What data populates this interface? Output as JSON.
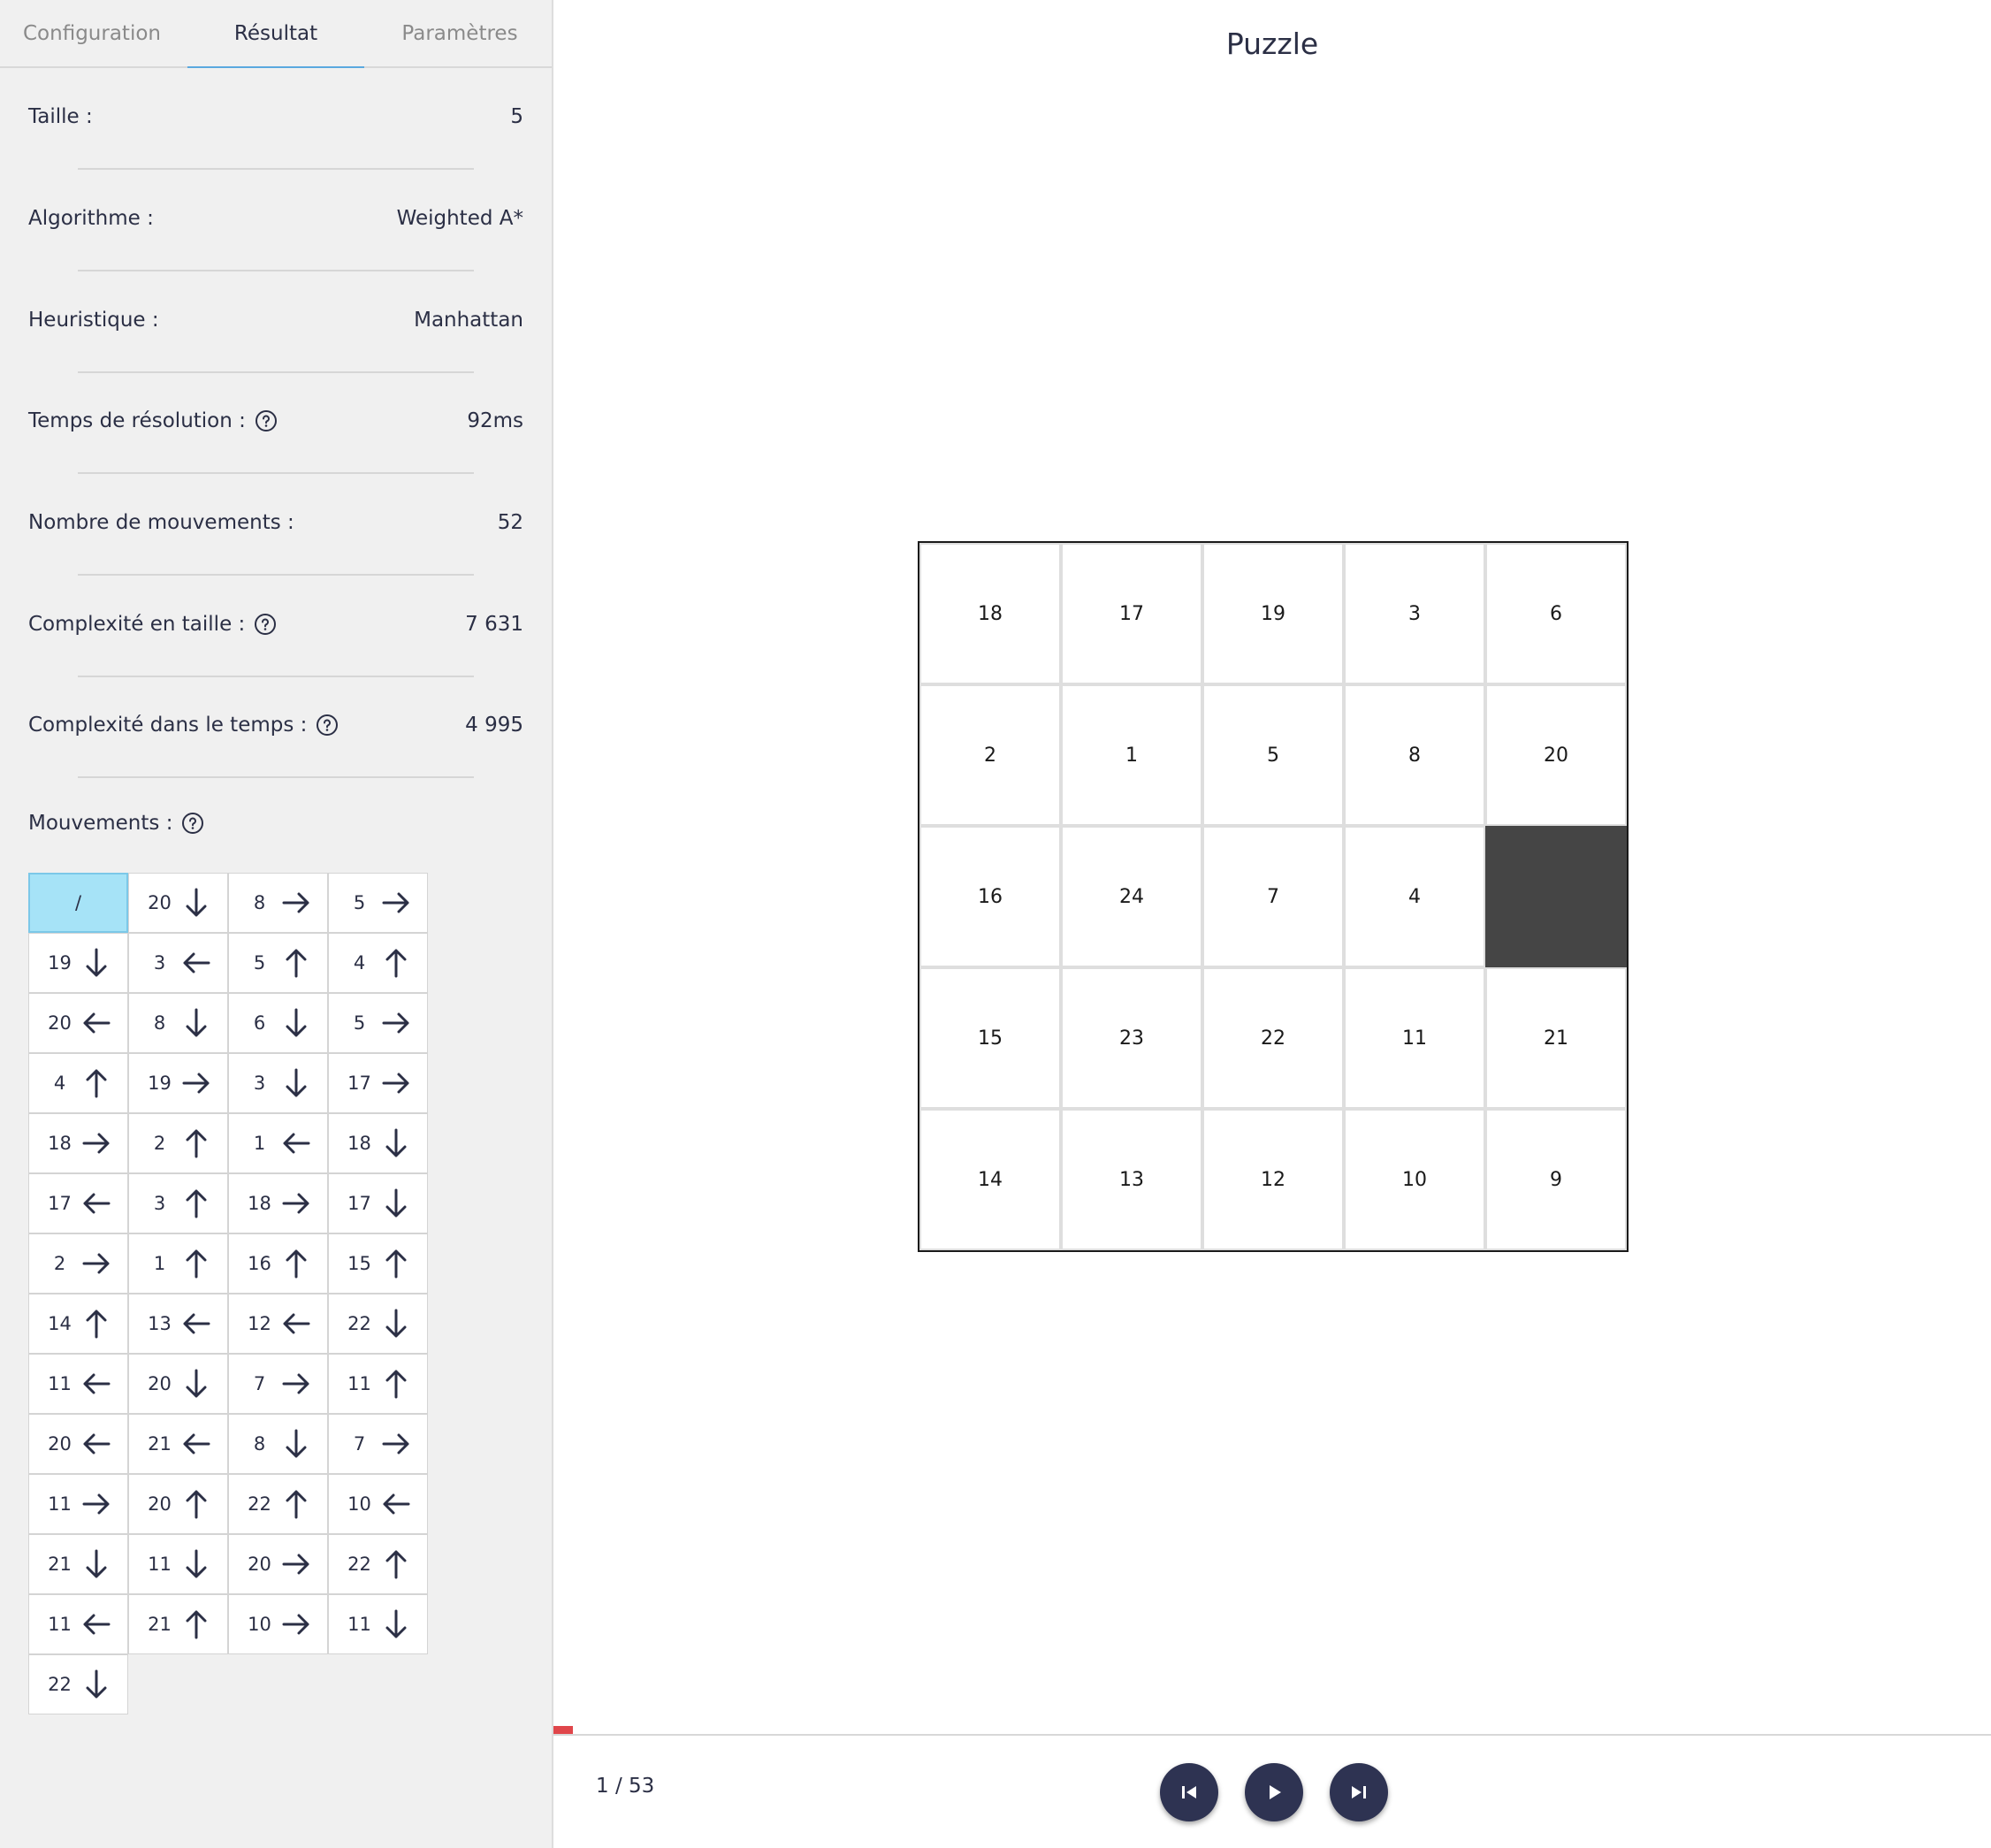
{
  "tabs": [
    {
      "label": "Configuration",
      "active": false
    },
    {
      "label": "Résultat",
      "active": true
    },
    {
      "label": "Paramètres",
      "active": false
    }
  ],
  "stats": [
    {
      "label": "Taille :",
      "value": "5",
      "help": false
    },
    {
      "label": "Algorithme :",
      "value": "Weighted A*",
      "help": false
    },
    {
      "label": "Heuristique :",
      "value": "Manhattan",
      "help": false
    },
    {
      "label": "Temps de résolution :",
      "value": "92ms",
      "help": true
    },
    {
      "label": "Nombre de mouvements :",
      "value": "52",
      "help": true
    },
    {
      "label": "Complexité en taille :",
      "value": "7 631",
      "help": true
    },
    {
      "label": "Complexité dans le temps :",
      "value": "4 995",
      "help": true
    }
  ],
  "moves_title": "Mouvements :",
  "moves": [
    {
      "tile": "/",
      "dir": null
    },
    {
      "tile": "20",
      "dir": "down"
    },
    {
      "tile": "8",
      "dir": "right"
    },
    {
      "tile": "5",
      "dir": "right"
    },
    {
      "tile": "19",
      "dir": "down"
    },
    {
      "tile": "3",
      "dir": "left"
    },
    {
      "tile": "5",
      "dir": "up"
    },
    {
      "tile": "4",
      "dir": "up"
    },
    {
      "tile": "20",
      "dir": "left"
    },
    {
      "tile": "8",
      "dir": "down"
    },
    {
      "tile": "6",
      "dir": "down"
    },
    {
      "tile": "5",
      "dir": "right"
    },
    {
      "tile": "4",
      "dir": "up"
    },
    {
      "tile": "19",
      "dir": "right"
    },
    {
      "tile": "3",
      "dir": "down"
    },
    {
      "tile": "17",
      "dir": "right"
    },
    {
      "tile": "18",
      "dir": "right"
    },
    {
      "tile": "2",
      "dir": "up"
    },
    {
      "tile": "1",
      "dir": "left"
    },
    {
      "tile": "18",
      "dir": "down"
    },
    {
      "tile": "17",
      "dir": "left"
    },
    {
      "tile": "3",
      "dir": "up"
    },
    {
      "tile": "18",
      "dir": "right"
    },
    {
      "tile": "17",
      "dir": "down"
    },
    {
      "tile": "2",
      "dir": "right"
    },
    {
      "tile": "1",
      "dir": "up"
    },
    {
      "tile": "16",
      "dir": "up"
    },
    {
      "tile": "15",
      "dir": "up"
    },
    {
      "tile": "14",
      "dir": "up"
    },
    {
      "tile": "13",
      "dir": "left"
    },
    {
      "tile": "12",
      "dir": "left"
    },
    {
      "tile": "22",
      "dir": "down"
    },
    {
      "tile": "11",
      "dir": "left"
    },
    {
      "tile": "20",
      "dir": "down"
    },
    {
      "tile": "7",
      "dir": "right"
    },
    {
      "tile": "11",
      "dir": "up"
    },
    {
      "tile": "20",
      "dir": "left"
    },
    {
      "tile": "21",
      "dir": "left"
    },
    {
      "tile": "8",
      "dir": "down"
    },
    {
      "tile": "7",
      "dir": "right"
    },
    {
      "tile": "11",
      "dir": "right"
    },
    {
      "tile": "20",
      "dir": "up"
    },
    {
      "tile": "22",
      "dir": "up"
    },
    {
      "tile": "10",
      "dir": "left"
    },
    {
      "tile": "21",
      "dir": "down"
    },
    {
      "tile": "11",
      "dir": "down"
    },
    {
      "tile": "20",
      "dir": "right"
    },
    {
      "tile": "22",
      "dir": "up"
    },
    {
      "tile": "11",
      "dir": "left"
    },
    {
      "tile": "21",
      "dir": "up"
    },
    {
      "tile": "10",
      "dir": "right"
    },
    {
      "tile": "11",
      "dir": "down"
    },
    {
      "tile": "22",
      "dir": "down"
    }
  ],
  "current_move_index": 0,
  "puzzle": {
    "title": "Puzzle",
    "size": 5,
    "tiles": [
      [
        "18",
        "17",
        "19",
        "3",
        "6"
      ],
      [
        "2",
        "1",
        "5",
        "8",
        "20"
      ],
      [
        "16",
        "24",
        "7",
        "4",
        ""
      ],
      [
        "15",
        "23",
        "22",
        "11",
        "21"
      ],
      [
        "14",
        "13",
        "12",
        "10",
        "9"
      ]
    ]
  },
  "player": {
    "step_text": "1 / 53",
    "progress_fraction": 0.0135,
    "progress_color": "#e0464b"
  },
  "controls": {
    "prev_icon": "skip-previous-icon",
    "play_icon": "play-icon",
    "next_icon": "skip-next-icon"
  },
  "colors": {
    "current_move_bg": "#a6e3f7",
    "empty_tile": "#454545",
    "control_button": "#2e3352",
    "active_tab_underline": "#5aa9df"
  }
}
